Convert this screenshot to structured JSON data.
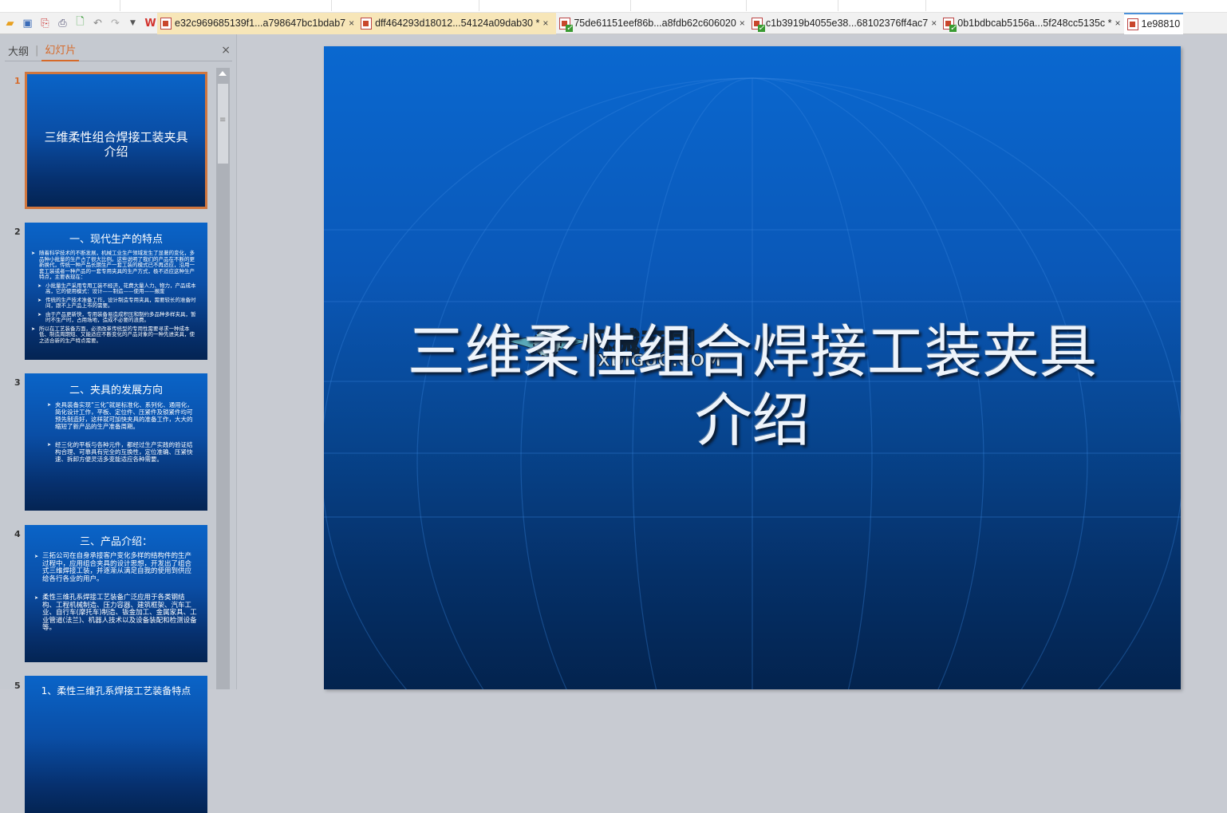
{
  "toolbar": {
    "icons": [
      "open-folder-icon",
      "save-icon",
      "export-pdf-icon",
      "print-icon",
      "print-preview-icon",
      "undo-icon",
      "redo-icon",
      "dropdown-icon",
      "wps-logo-icon"
    ]
  },
  "tabs": [
    {
      "label": "e32c969685139f1...a798647bc1bdab7",
      "state": "open"
    },
    {
      "label": "dff464293d18012...54124a09dab30 *",
      "state": "open"
    },
    {
      "label": "75de61151eef86b...a8fdb62c606020",
      "state": "normal"
    },
    {
      "label": "c1b3919b4055e38...68102376ff4ac7",
      "state": "normal"
    },
    {
      "label": "0b1bdbcab5156a...5f248cc5135c *",
      "state": "normal"
    },
    {
      "label": "1e98810",
      "state": "active"
    }
  ],
  "panel": {
    "tab_outline": "大纲",
    "tab_slides": "幻灯片",
    "separator": "|",
    "close": "×"
  },
  "slides": [
    {
      "num": "1",
      "title": "三维柔性组合焊接工装夹具介绍"
    },
    {
      "num": "2",
      "title": "一、现代生产的特点",
      "bullets": [
        "随着科学技术的不断发展，机械工业生产领域发生了显著的变化，多品种小批量的生产占了很大比例。这些说明了我们的产品在不断的更新换代，传统一种产品长期生产一套工装的模式已不再适应，沿用一套工装或者一种产品的一套专用夹具的生产方式，极不适应这种生产特点，主要表现在：",
        "小批量生产采用专用工装不经济，花费大量人力、物力，产品成本高，它的使用模式：设计——制造——使用——报废",
        "传统的生产技术准备工作，设计制造专用夹具，需要较长的准备时间，跟不上产品上市的需要。",
        "由于产品更新快，专用装备易造成积压和制约多品种多样夹具，暂时不生产时，占用场地，造成不必要的浪费。",
        "所以在工艺装备方面，必须改革传统型的专用性需要寻求一种成本低、制造周期短、又能适应不断变化的产品对象的一种先进夹具，使之适合新的生产特点需要。"
      ]
    },
    {
      "num": "3",
      "title": "二、夹具的发展方向",
      "bullets": [
        "夹具装备实现“三化”就是标准化、系列化、通用化，简化设计工作，平板、定位件、压紧件及锁紧件均可预先制造好，这样就可加快夹具的准备工作，大大的缩短了新产品的生产准备周期。",
        "经三化的平板与各种元件，都经过生产实践的验证结构合理、可靠具有完全的互换性，定位准确、压紧快速、拆卸方便灵活多变能适应各种需要。"
      ]
    },
    {
      "num": "4",
      "title": "三、产品介绍：",
      "bullets": [
        "三拓公司在自身承接客户变化多样的结构件的生产过程中，应用组合夹具的设计思想，开发出了组合式三维焊接工装，并逐渐从满足自我的使用到供应给各行各业的用户。",
        "柔性三维孔系焊接工艺装备广泛应用于各类钢结构、工程机械制造、压力容器、建筑框架、汽车工业、自行车(摩托车)制造、钣金加工、金属家具、工业管道(法兰)、机器人技术以及设备装配和检测设备等。"
      ]
    },
    {
      "num": "5",
      "title": "1、柔性三维孔系焊接工艺装备特点"
    }
  ],
  "main_slide": {
    "title_line1": "三维柔性组合焊接工装夹具",
    "title_line2": "介绍"
  },
  "watermark": {
    "cn": "机械帝国",
    "en": "JXDIGUO.COM"
  },
  "colors": {
    "accent": "#d66a2a",
    "slide_top": "#0a68d0",
    "slide_bottom": "#03234e"
  }
}
